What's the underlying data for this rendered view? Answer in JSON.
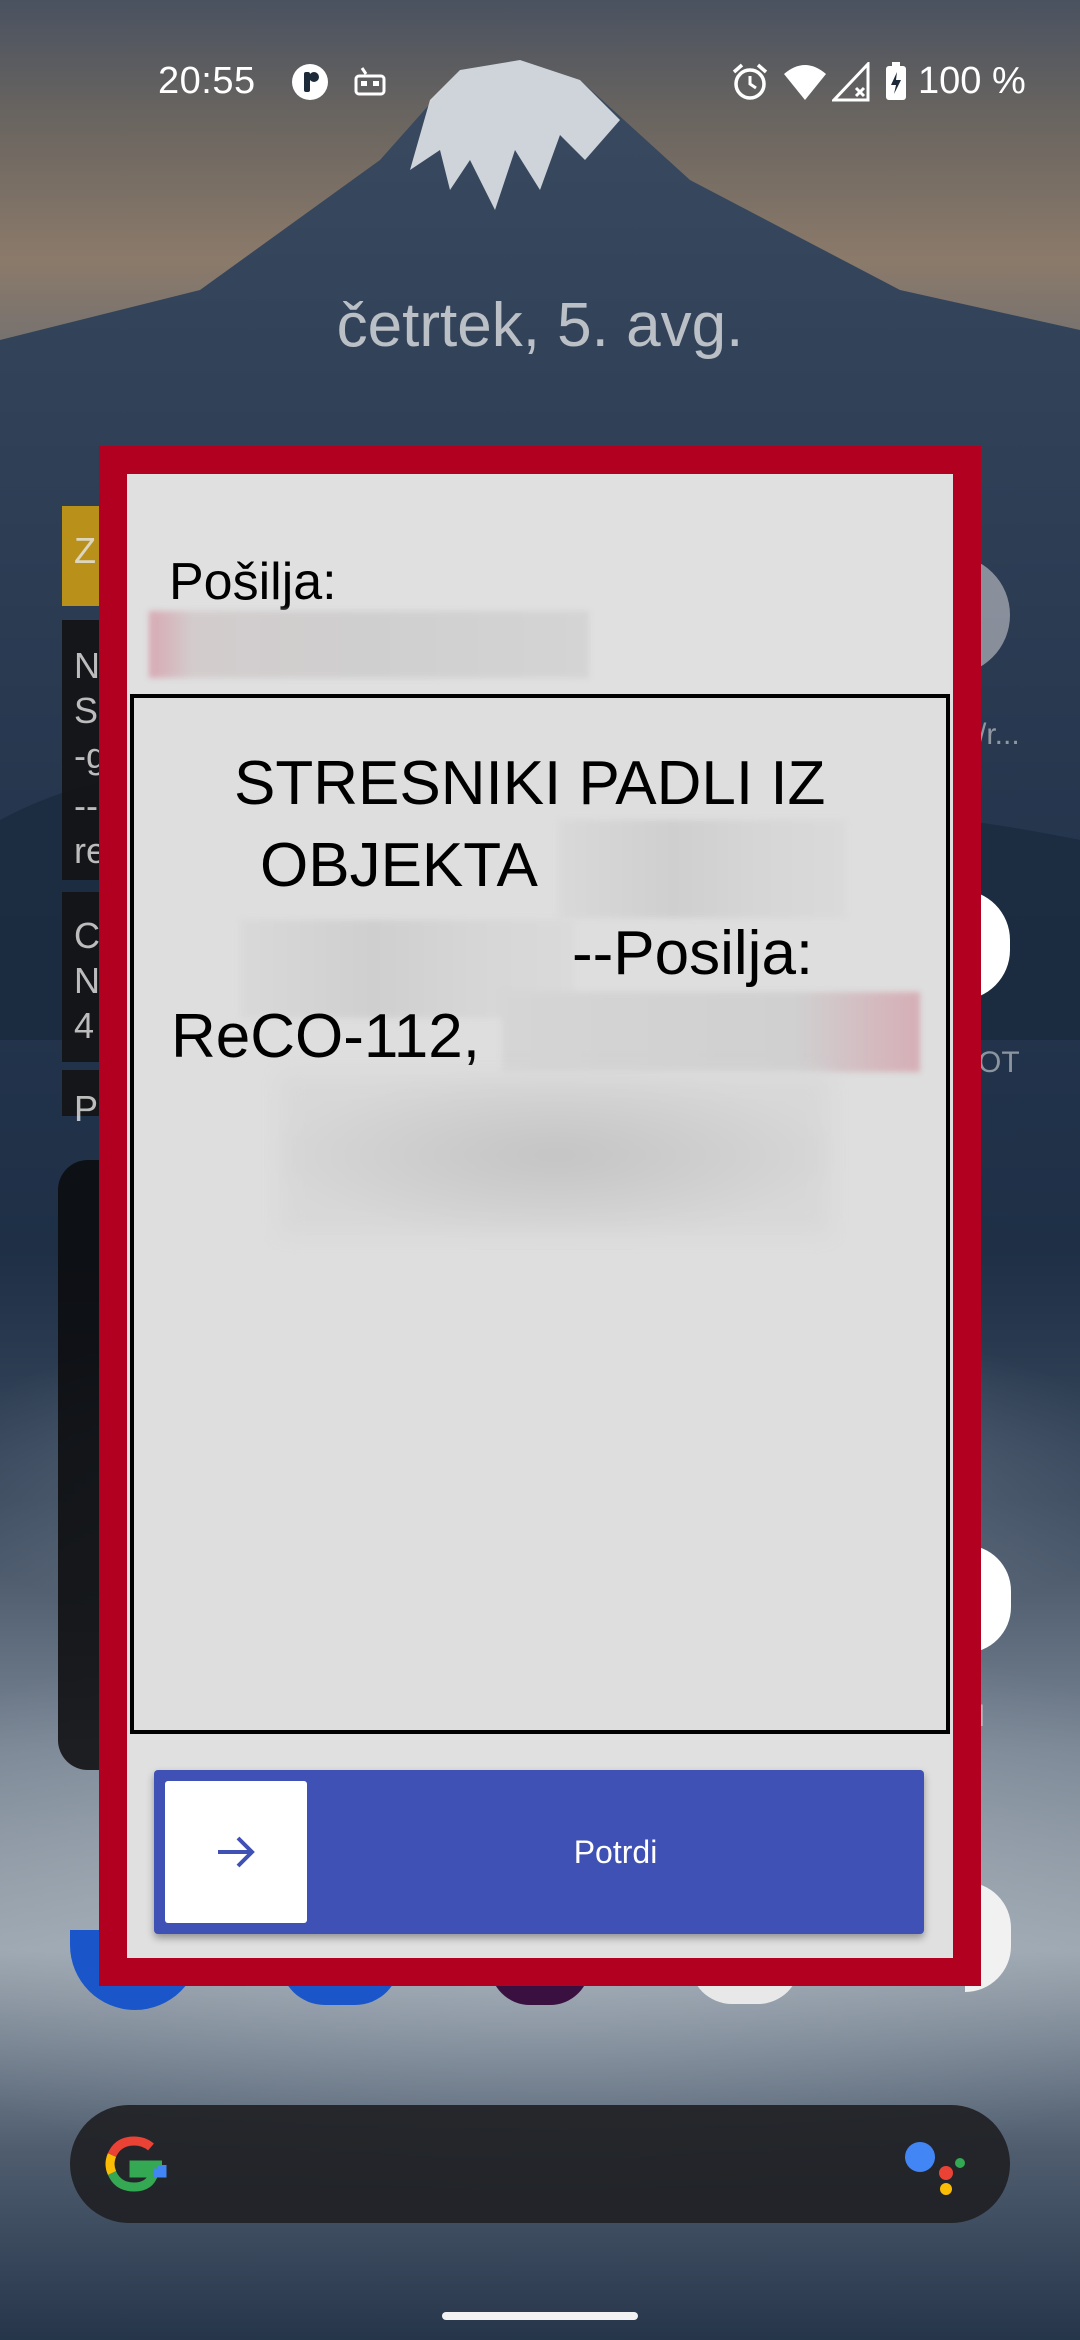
{
  "status_bar": {
    "time": "20:55",
    "battery": "100 %",
    "icons": [
      "app-notification-icon",
      "traffic-icon",
      "alarm-icon",
      "wifi-icon",
      "cellular-signal-icon",
      "battery-charging-icon"
    ]
  },
  "lockscreen": {
    "date": "četrtek, 5. avg."
  },
  "alert": {
    "frame_color": "#b20021",
    "sender_label": "Pošilja:",
    "message_lines": [
      "STRESNIKI PADLI IZ",
      "OBJEKTA",
      "--Posilja:",
      "ReCO-112,"
    ],
    "confirm_label": "Potrdi",
    "confirm_icon": "arrow-right-icon",
    "button_color": "#3f51b5"
  },
  "background_fragments": {
    "left_letters": [
      "Z",
      "N",
      "S",
      "-g",
      "--",
      "re",
      "C",
      "N",
      "4",
      "P"
    ],
    "right_fragments": [
      "/r...",
      "OT",
      "l"
    ]
  },
  "search": {
    "logo": "google-g-icon",
    "assistant": "google-assistant-icon"
  }
}
